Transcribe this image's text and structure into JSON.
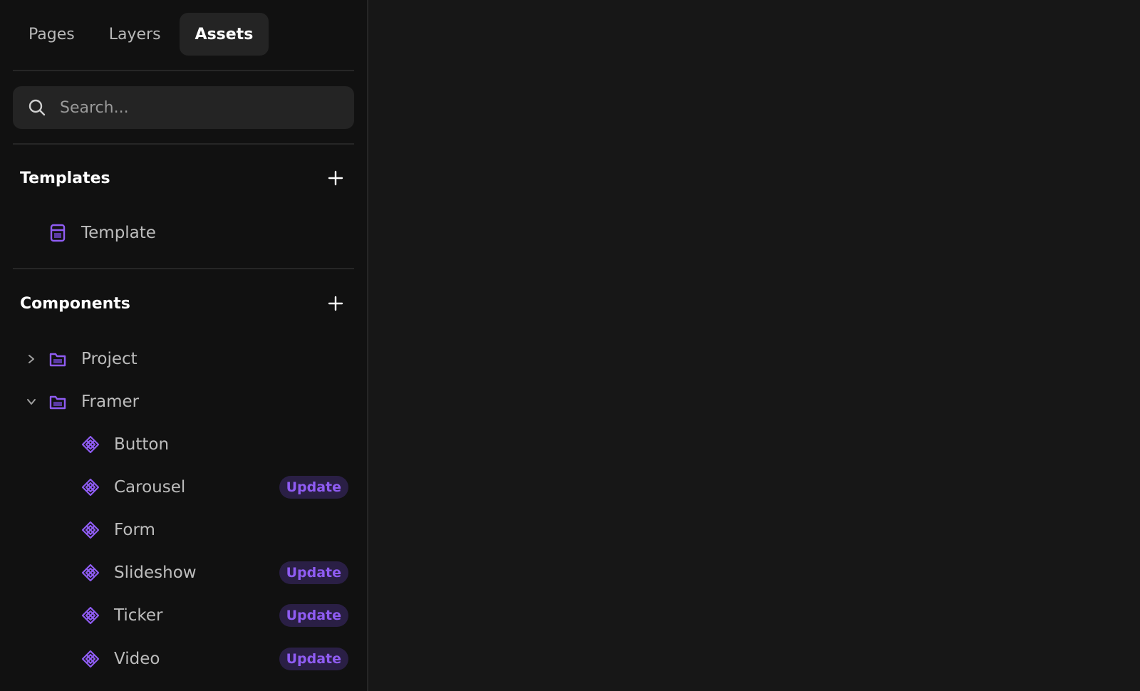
{
  "tabs": [
    {
      "label": "Pages",
      "active": false
    },
    {
      "label": "Layers",
      "active": false
    },
    {
      "label": "Assets",
      "active": true
    }
  ],
  "search": {
    "placeholder": "Search...",
    "value": "",
    "icon": "search-icon"
  },
  "templates": {
    "title": "Templates",
    "add_icon": "plus-icon",
    "items": [
      {
        "label": "Template",
        "icon": "template-icon"
      }
    ]
  },
  "components": {
    "title": "Components",
    "add_icon": "plus-icon",
    "folders": [
      {
        "label": "Project",
        "expanded": false,
        "icon": "folder-icon"
      },
      {
        "label": "Framer",
        "expanded": true,
        "icon": "folder-icon"
      }
    ],
    "items": [
      {
        "label": "Button",
        "badge": ""
      },
      {
        "label": "Carousel",
        "badge": "Update"
      },
      {
        "label": "Form",
        "badge": ""
      },
      {
        "label": "Slideshow",
        "badge": "Update"
      },
      {
        "label": "Ticker",
        "badge": "Update"
      },
      {
        "label": "Video",
        "badge": "Update"
      }
    ]
  },
  "colors": {
    "accent": "#8f5cf2",
    "sidebar_bg": "#111111",
    "canvas_bg": "#171717",
    "badge_bg": "#2a1f45"
  }
}
